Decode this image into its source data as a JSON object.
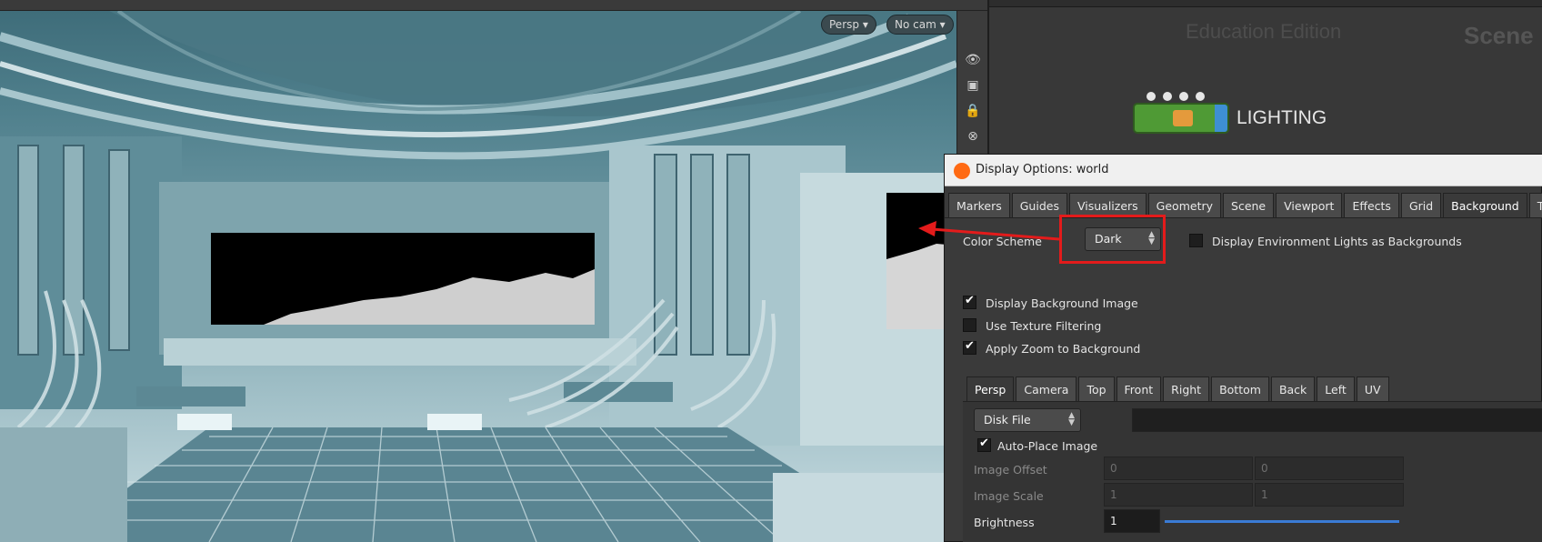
{
  "viewport": {
    "persp_button": "Persp",
    "camera_button": "No cam"
  },
  "network": {
    "watermark": "Education Edition",
    "context_label": "Scene",
    "node_label": "LIGHTING"
  },
  "dialog": {
    "title": "Display Options:  world",
    "tabs": [
      "Markers",
      "Guides",
      "Visualizers",
      "Geometry",
      "Scene",
      "Viewport",
      "Effects",
      "Grid",
      "Background",
      "Texture"
    ],
    "active_tab": "Background",
    "color_scheme_label": "Color Scheme",
    "color_scheme_value": "Dark",
    "env_lights_label": "Display Environment Lights as Backgrounds",
    "env_lights_checked": false,
    "display_bg_image_label": "Display Background Image",
    "display_bg_image_checked": true,
    "texture_filtering_label": "Use Texture Filtering",
    "texture_filtering_checked": false,
    "apply_zoom_label": "Apply Zoom to Background",
    "apply_zoom_checked": true,
    "view_tabs": [
      "Persp",
      "Camera",
      "Top",
      "Front",
      "Right",
      "Bottom",
      "Back",
      "Left",
      "UV"
    ],
    "active_view_tab": "Persp",
    "source_value": "Disk File",
    "auto_place_label": "Auto-Place Image",
    "auto_place_checked": true,
    "image_offset_label": "Image Offset",
    "image_offset_values": [
      "0",
      "0"
    ],
    "image_scale_label": "Image Scale",
    "image_scale_values": [
      "1",
      "1"
    ],
    "brightness_label": "Brightness",
    "brightness_value": "1"
  },
  "colors": {
    "highlight": "#e31b1b",
    "houdini_orange": "#ff6a13",
    "node_green": "#4f9a35"
  }
}
